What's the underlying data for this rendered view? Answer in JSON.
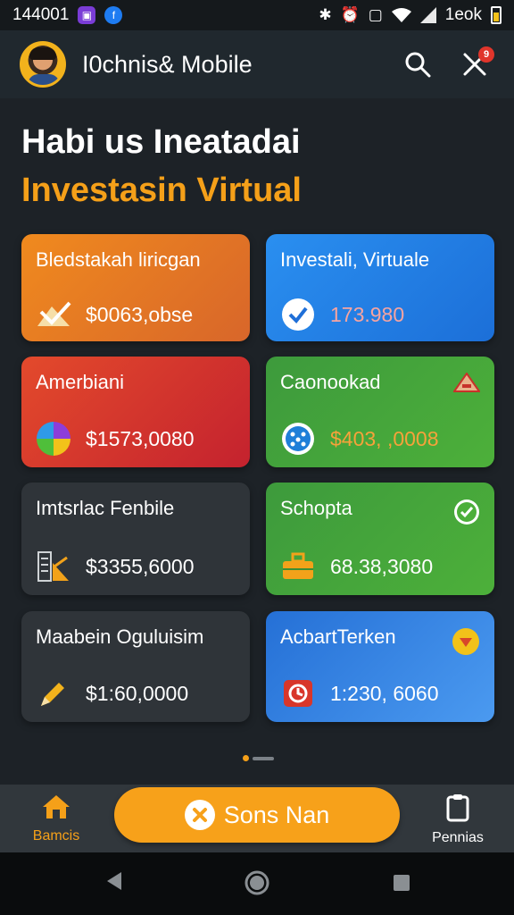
{
  "status_bar": {
    "time": "144001",
    "right_text": "1eok",
    "icons": [
      "purple-app-icon",
      "facebook-icon",
      "bluetooth-icon",
      "alarm-icon",
      "vibrate-icon",
      "wifi-icon",
      "signal-icon",
      "battery-icon"
    ]
  },
  "app_bar": {
    "title": "I0chnis& Mobile",
    "notification_count": "9"
  },
  "page": {
    "heading": "Habi us Ineatadai",
    "subheading": "Investasin Virtual"
  },
  "cards": [
    {
      "label": "Bledstakah liricgan",
      "value": "$0063,obse",
      "color": "orange",
      "icon": "scale-icon"
    },
    {
      "label": "Investali, Virtuale",
      "value": "173.980",
      "color": "blue",
      "icon": "check-circle-icon"
    },
    {
      "label": "Amerbiani",
      "value": "$1573,0080",
      "color": "red",
      "icon": "pie-chart-icon"
    },
    {
      "label": "Caonookad",
      "value": "$403, ,0008",
      "color": "green",
      "icon": "dots-circle-icon",
      "corner_icon": "tent-icon"
    },
    {
      "label": "Imtsrlac Fenbile",
      "value": "$3355,6000",
      "color": "dark",
      "icon": "building-icon"
    },
    {
      "label": "Schopta",
      "value": "68.38,3080",
      "color": "green",
      "icon": "briefcase-icon",
      "corner_icon": "check-badge-icon"
    },
    {
      "label": "Maabein Oguluisim",
      "value": "$1:60,0000",
      "color": "dark",
      "icon": "pencil-icon"
    },
    {
      "label": "AcbartTerken",
      "value": "1:230, 6060",
      "color": "blue",
      "icon": "clock-box-icon",
      "corner_icon": "shield-badge-icon"
    }
  ],
  "bottom_nav": {
    "home_label": "Bamcis",
    "cta_label": "Sons Nan",
    "right_label": "Pennias"
  }
}
